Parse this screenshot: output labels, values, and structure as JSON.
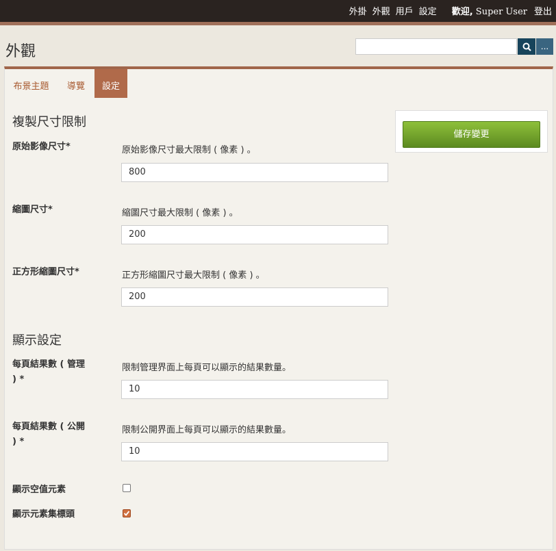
{
  "topnav": {
    "plugins": "外掛",
    "appearance": "外觀",
    "users": "用戶",
    "settings": "設定",
    "welcome_prefix": "歡迎",
    "welcome_sep": ",",
    "username": "Super User",
    "logout": "登出"
  },
  "header": {
    "title": "外觀",
    "search_placeholder": "",
    "search_icon": "search-icon",
    "advanced_label": "..."
  },
  "tabs": [
    {
      "label": "布景主題",
      "active": false
    },
    {
      "label": "導覽",
      "active": false
    },
    {
      "label": "設定",
      "active": true
    }
  ],
  "sections": {
    "derivative": {
      "title": "複製尺寸限制",
      "fields": [
        {
          "label": "原始影像尺寸*",
          "desc": "原始影像尺寸最大限制 ( 像素 ) 。",
          "value": "800"
        },
        {
          "label": "縮圖尺寸*",
          "desc": "縮圖尺寸最大限制 ( 像素 ) 。",
          "value": "200"
        },
        {
          "label": "正方形縮圖尺寸*",
          "desc": "正方形縮圖尺寸最大限制 ( 像素 ) 。",
          "value": "200"
        }
      ]
    },
    "display": {
      "title": "顯示設定",
      "fields": [
        {
          "label": "每頁結果數 ( 管理 ) *",
          "desc": "限制管理界面上每頁可以顯示的結果數量。",
          "value": "10"
        },
        {
          "label": "每頁結果數 ( 公開 ) *",
          "desc": "限制公開界面上每頁可以顯示的結果數量。",
          "value": "10"
        }
      ],
      "checkboxes": [
        {
          "label": "顯示空值元素",
          "checked": false
        },
        {
          "label": "顯示元素集標頭",
          "checked": true
        }
      ]
    }
  },
  "save_button": "儲存變更",
  "colors": {
    "topbar": "#2a2320",
    "accent": "#a0654a",
    "tab_active": "#b06a4a",
    "save_green": "#6e9e2a",
    "search_btn": "#17445b"
  }
}
